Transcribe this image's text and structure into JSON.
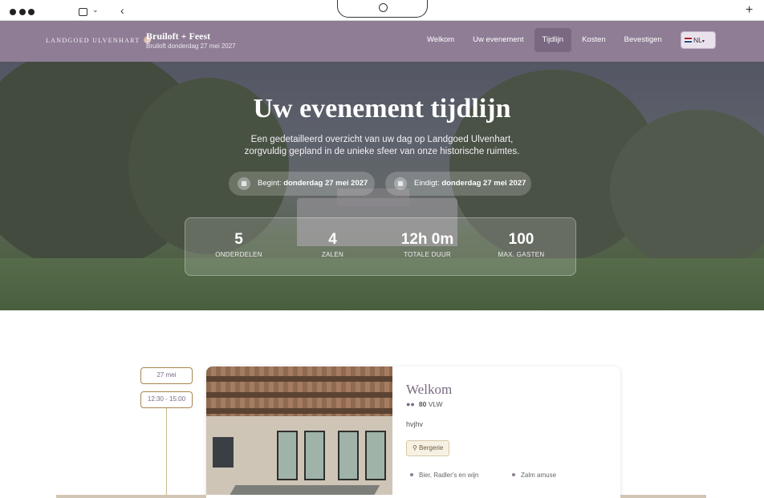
{
  "header": {
    "logo_text": "LANDGOED ULVENHART",
    "title": "Bruiloft + Feest",
    "subtitle": "Bruiloft donderdag 27 mei 2027",
    "nav": [
      {
        "label": "Welkom"
      },
      {
        "label": "Uw evenement"
      },
      {
        "label": "Tijdlijn"
      },
      {
        "label": "Kosten"
      },
      {
        "label": "Bevestigen"
      }
    ],
    "language": "NL",
    "active_color": "#7a6882",
    "bar_color": "#8e7d95"
  },
  "hero": {
    "title": "Uw evenement tijdlijn",
    "description": "Een gedetailleerd overzicht van uw dag op Landgoed Ulvenhart, zorgvuldig gepland in de unieke sfeer van onze historische ruimtes.",
    "start_label": "Begint:",
    "start_value": "donderdag 27 mei 2027",
    "end_label": "Eindigt:",
    "end_value": "donderdag 27 mei 2027",
    "stats": [
      {
        "value": "5",
        "label": "ONDERDELEN"
      },
      {
        "value": "4",
        "label": "ZALEN"
      },
      {
        "value": "12h 0m",
        "label": "TOTALE DUUR"
      },
      {
        "value": "100",
        "label": "MAX. GASTEN"
      }
    ]
  },
  "timeline": {
    "date": "27 mei",
    "time": "12:30 - 15:00",
    "card": {
      "title": "Welkom",
      "guests_count": "80",
      "guests_type": "VLW",
      "description": "hvjhv",
      "room": "Bergerie",
      "items": [
        "Bier, Radler's en wijn",
        "Zalm amuse"
      ]
    }
  }
}
